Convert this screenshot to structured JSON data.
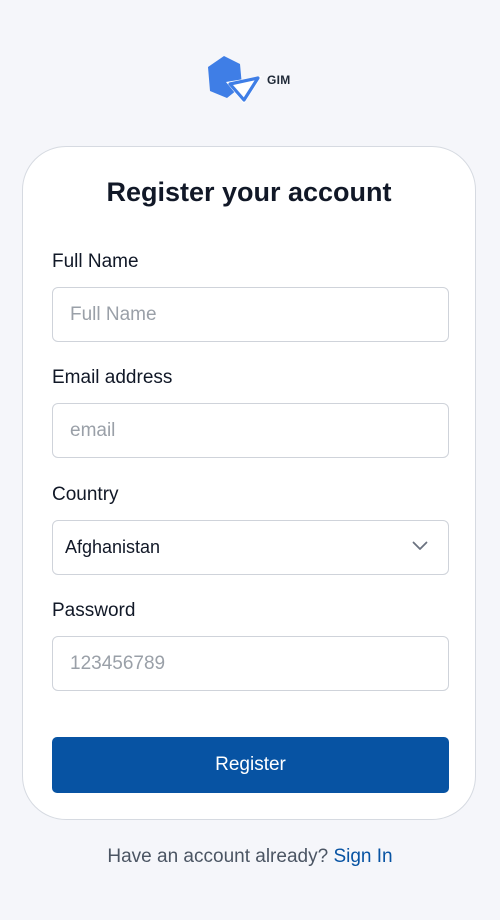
{
  "logo": {
    "text": "GIM",
    "icon": "gim-logo-icon",
    "color": "#3f7ee6"
  },
  "form": {
    "title": "Register your account",
    "full_name": {
      "label": "Full Name",
      "placeholder": "Full Name",
      "value": ""
    },
    "email": {
      "label": "Email address",
      "placeholder": "email",
      "value": ""
    },
    "country": {
      "label": "Country",
      "selected": "Afghanistan",
      "icon": "chevron-down-icon"
    },
    "password": {
      "label": "Password",
      "placeholder": "123456789",
      "value": ""
    },
    "submit_label": "Register"
  },
  "footer": {
    "prompt": "Have an account already?",
    "link_label": "Sign In"
  },
  "colors": {
    "background": "#f5f6fa",
    "primary": "#0753a3",
    "logo_blue": "#3f7ee6"
  }
}
